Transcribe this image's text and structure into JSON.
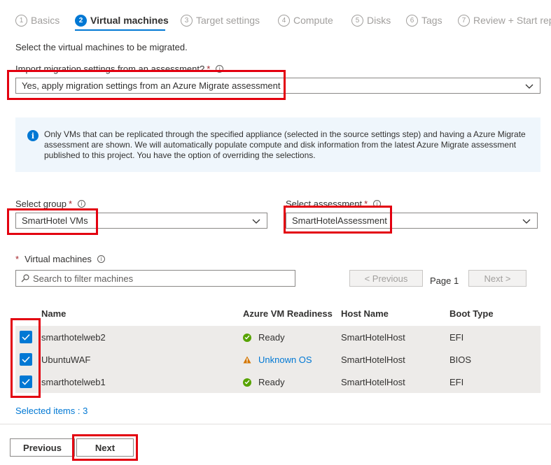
{
  "tabs": [
    {
      "num": "1",
      "label": "Basics"
    },
    {
      "num": "2",
      "label": "Virtual machines"
    },
    {
      "num": "3",
      "label": "Target settings"
    },
    {
      "num": "4",
      "label": "Compute"
    },
    {
      "num": "5",
      "label": "Disks"
    },
    {
      "num": "6",
      "label": "Tags"
    },
    {
      "num": "7",
      "label": "Review + Start rep"
    }
  ],
  "intro": "Select the virtual machines to be migrated.",
  "import": {
    "label": "Import migration settings from an assessment?",
    "value": "Yes, apply migration settings from an Azure Migrate assessment"
  },
  "info": {
    "text": "Only VMs that can be replicated through the specified appliance (selected  in the source settings step) and having a Azure Migrate assessment are shown. We will automatically populate compute and disk information from the latest Azure Migrate assessment published to this project. You have the option of overriding the selections."
  },
  "group": {
    "label": "Select group",
    "value": "SmartHotel VMs"
  },
  "assessment": {
    "label": "Select assessment",
    "value": "SmartHotelAssessment"
  },
  "vms": {
    "label": "Virtual machines",
    "search_placeholder": "Search to filter machines",
    "prev_label": "< Previous",
    "page_label": "Page 1",
    "next_label": "Next >"
  },
  "table": {
    "headers": [
      "Name",
      "Azure VM Readiness",
      "Host Name",
      "Boot Type"
    ],
    "rows": [
      {
        "name": "smarthotelweb2",
        "readiness": "Ready",
        "host": "SmartHotelHost",
        "boot": "EFI"
      },
      {
        "name": "UbuntuWAF",
        "readiness": "Unknown OS",
        "host": "SmartHotelHost",
        "boot": "BIOS"
      },
      {
        "name": "smarthotelweb1",
        "readiness": "Ready",
        "host": "SmartHotelHost",
        "boot": "EFI"
      }
    ]
  },
  "selected": "Selected items : 3",
  "footer": {
    "previous": "Previous",
    "next": "Next"
  },
  "colors": {
    "accent": "#0078d4",
    "highlight": "#e3000f",
    "ready": "#57a300",
    "warning": "#d47500"
  }
}
